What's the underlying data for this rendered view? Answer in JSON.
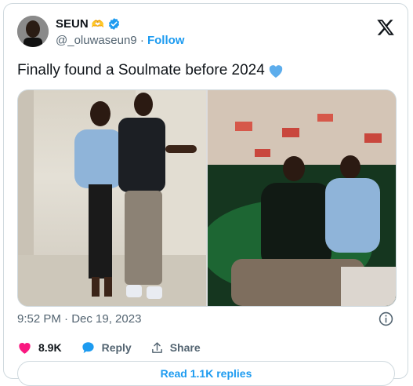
{
  "author": {
    "display_name": "SEUN",
    "handle": "@_oluwaseun9",
    "separator": "·",
    "follow_label": "Follow",
    "verified": true,
    "name_emoji": "🫶"
  },
  "tweet": {
    "text": "Finally found a Soulmate before 2024",
    "text_emoji": "💙",
    "timestamp": "9:52 PM · Dec 19, 2023"
  },
  "actions": {
    "likes": "8.9K",
    "reply_label": "Reply",
    "share_label": "Share"
  },
  "replies_button": "Read 1.1K replies",
  "colors": {
    "accent": "#1d9bf0",
    "like": "#f91880",
    "text": "#0f1419",
    "muted": "#536471",
    "border": "#cfd9de"
  },
  "icons": [
    "x-logo-icon",
    "verified-badge-icon",
    "heart-icon",
    "reply-icon",
    "share-icon",
    "info-icon"
  ]
}
